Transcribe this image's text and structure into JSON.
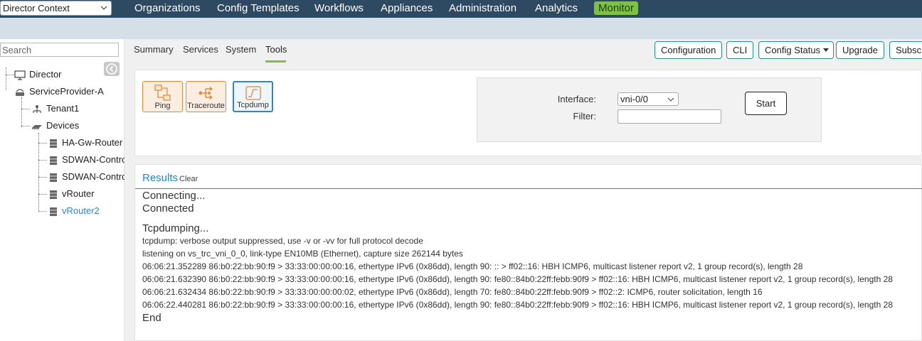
{
  "header": {
    "context_select": "Director Context",
    "nav": [
      "Organizations",
      "Config Templates",
      "Workflows",
      "Appliances",
      "Administration",
      "Analytics",
      "Monitor"
    ],
    "active_nav": "Monitor"
  },
  "sidebar": {
    "search_placeholder": "Search",
    "tree": [
      {
        "label": "Director",
        "icon": "monitor-icon"
      },
      {
        "label": "ServiceProvider-A",
        "icon": "provider-icon"
      },
      {
        "label": "Tenant1",
        "icon": "tenant-icon"
      },
      {
        "label": "Devices",
        "icon": "devices-icon"
      },
      {
        "label": "HA-Gw-Router",
        "icon": "device-icon"
      },
      {
        "label": "SDWAN-Contro",
        "icon": "device-icon"
      },
      {
        "label": "SDWAN-Contro",
        "icon": "device-icon"
      },
      {
        "label": "vRouter",
        "icon": "device-icon"
      },
      {
        "label": "vRouter2",
        "icon": "device-icon",
        "selected": true
      }
    ]
  },
  "tabs": [
    "Summary",
    "Services",
    "System",
    "Tools"
  ],
  "active_tab": "Tools",
  "actions": [
    "Configuration",
    "CLI",
    "Config Status",
    "Upgrade",
    "Subscr"
  ],
  "tools": [
    {
      "label": "Ping",
      "icon": "ping-icon"
    },
    {
      "label": "Traceroute",
      "icon": "traceroute-icon"
    },
    {
      "label": "Tcpdump",
      "icon": "tcpdump-icon",
      "active": true
    }
  ],
  "form": {
    "interface_label": "Interface:",
    "interface_value": "vni-0/0",
    "filter_label": "Filter:",
    "filter_value": "",
    "start_label": "Start"
  },
  "results": {
    "title": "Results",
    "clear_label": "Clear",
    "lines": [
      {
        "text": "Connecting...",
        "size": "big"
      },
      {
        "text": "Connected",
        "size": "big"
      },
      {
        "text": "Tcpdumping...",
        "size": "big"
      },
      {
        "text": "tcpdump: verbose output suppressed, use -v or -vv for full protocol decode",
        "size": "small"
      },
      {
        "text": "listening on vs_trc_vni_0_0, link-type EN10MB (Ethernet), capture size 262144 bytes",
        "size": "small"
      },
      {
        "text": "06:06:21.352289 86:b0:22:bb:90:f9 > 33:33:00:00:00:16, ethertype IPv6 (0x86dd), length 90: :: > ff02::16: HBH ICMP6, multicast listener report v2, 1 group record(s), length 28",
        "size": "small"
      },
      {
        "text": "06:06:21.632390 86:b0:22:bb:90:f9 > 33:33:00:00:00:16, ethertype IPv6 (0x86dd), length 90: fe80::84b0:22ff:febb:90f9 > ff02::16: HBH ICMP6, multicast listener report v2, 1 group record(s), length 28",
        "size": "small"
      },
      {
        "text": "06:06:21.632434 86:b0:22:bb:90:f9 > 33:33:00:00:00:02, ethertype IPv6 (0x86dd), length 70: fe80::84b0:22ff:febb:90f9 > ff02::2: ICMP6, router solicitation, length 16",
        "size": "small"
      },
      {
        "text": "06:06:22.440281 86:b0:22:bb:90:f9 > 33:33:00:00:00:16, ethertype IPv6 (0x86dd), length 90: fe80::84b0:22ff:febb:90f9 > ff02::16: HBH ICMP6, multicast listener report v2, 1 group record(s), length 28",
        "size": "small"
      },
      {
        "text": "End",
        "size": "big"
      }
    ]
  },
  "colors": {
    "nav_bg": "#2e4a62",
    "monitor_badge": "#7dc243",
    "accent_teal": "#2a8f86",
    "results_title": "#1f8bc4",
    "tool_orange": "#e08a3a",
    "selected_blue": "#2f86c8"
  }
}
